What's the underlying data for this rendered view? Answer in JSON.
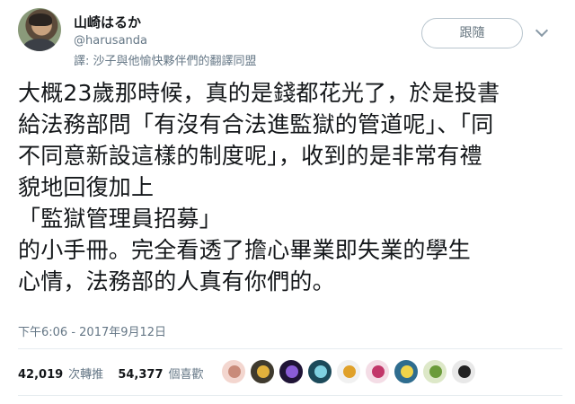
{
  "user": {
    "name": "山崎はるか",
    "handle": "@harusanda",
    "translation_note": "譯: 沙子與他愉快夥伴們的翻譯同盟"
  },
  "follow_button": "跟隨",
  "tweet": {
    "lines": [
      "大概23歲那時候，真的是錢都花光了，於是投書",
      "給法務部問「有沒有合法進監獄的管道呢」、「同",
      "不同意新設這樣的制度呢」，收到的是非常有禮",
      "貌地回復加上",
      "「監獄管理員招募」",
      "的小手冊。完全看透了擔心畢業即失業的學生",
      "心情，法務部的人真有你們的。"
    ]
  },
  "timestamp": "下午6:06 - 2017年9月12日",
  "stats": {
    "retweets_count": "42,019",
    "retweets_label": "次轉推",
    "likes_count": "54,377",
    "likes_label": "個喜歡"
  },
  "likers": [
    {
      "name": "liker-avatar-1",
      "bg": "#f3d6cf",
      "fg": "#c98b7a"
    },
    {
      "name": "liker-avatar-2",
      "bg": "#3f3a2e",
      "fg": "#e2b13c"
    },
    {
      "name": "liker-avatar-3",
      "bg": "#1f1436",
      "fg": "#8a5cd6"
    },
    {
      "name": "liker-avatar-4",
      "bg": "#1c4a5a",
      "fg": "#7fd0e0"
    },
    {
      "name": "liker-avatar-5",
      "bg": "#f1f1f1",
      "fg": "#e0a12a"
    },
    {
      "name": "liker-avatar-6",
      "bg": "#f4dde6",
      "fg": "#c2376a"
    },
    {
      "name": "liker-avatar-7",
      "bg": "#2f6d8f",
      "fg": "#f0d44a"
    },
    {
      "name": "liker-avatar-8",
      "bg": "#dde8c8",
      "fg": "#6b9b3a"
    },
    {
      "name": "liker-avatar-9",
      "bg": "#e8e8e8",
      "fg": "#222222"
    }
  ]
}
